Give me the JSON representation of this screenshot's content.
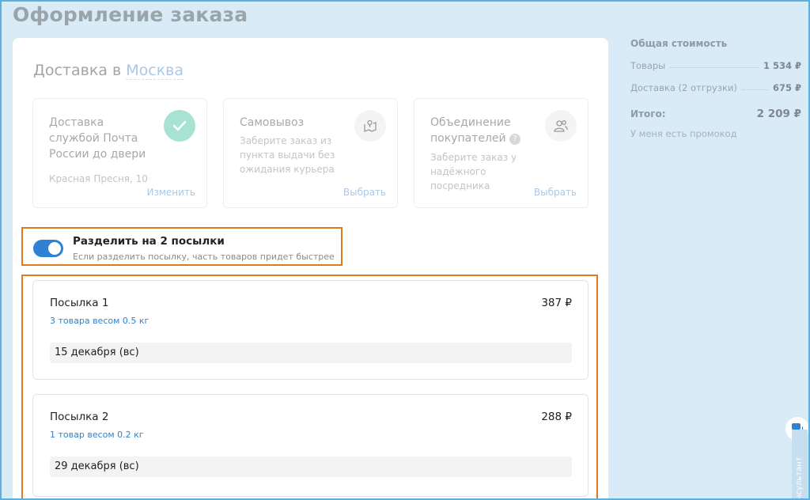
{
  "page": {
    "title": "Оформление заказа"
  },
  "delivery": {
    "title_prefix": "Доставка в",
    "city": "Москва",
    "options": [
      {
        "name": "Доставка службой Почта России до двери",
        "desc": "Красная Пресня, 10",
        "action": "Изменить",
        "icon": "check-icon",
        "selected": true
      },
      {
        "name": "Самовывоз",
        "desc": "Заберите заказ из пункта выдачи без ожидания курьера",
        "action": "Выбрать",
        "icon": "map-pin-icon",
        "selected": false
      },
      {
        "name": "Объединение покупателей",
        "desc": "Заберите заказ у надёжного посредника",
        "action": "Выбрать",
        "icon": "users-icon",
        "selected": false,
        "help_badge": "?"
      }
    ]
  },
  "split": {
    "enabled": true,
    "title": "Разделить на 2 посылки",
    "subtitle": "Если разделить посылку, часть товаров придет быстрее"
  },
  "parcels": [
    {
      "name": "Посылка 1",
      "price": "387 ₽",
      "items": "3 товара весом 0.5 кг",
      "date": "15 декабря (вс)"
    },
    {
      "name": "Посылка 2",
      "price": "288 ₽",
      "items": "1 товар весом 0.2 кг",
      "date": "29 декабря (вс)"
    }
  ],
  "summary": {
    "title": "Общая стоимость",
    "rows": [
      {
        "label": "Товары",
        "value": "1 534 ₽"
      },
      {
        "label": "Доставка (2 отгрузки)",
        "value": "675 ₽"
      }
    ],
    "total_label": "Итого:",
    "total_value": "2 209 ₽",
    "promo": "У меня есть промокод"
  },
  "consultant": {
    "label": "нсультант"
  },
  "colors": {
    "accent": "#2f82d1",
    "highlight": "#e07b1b",
    "selected": "#a7e3d2",
    "background": "#d9ebf6"
  }
}
